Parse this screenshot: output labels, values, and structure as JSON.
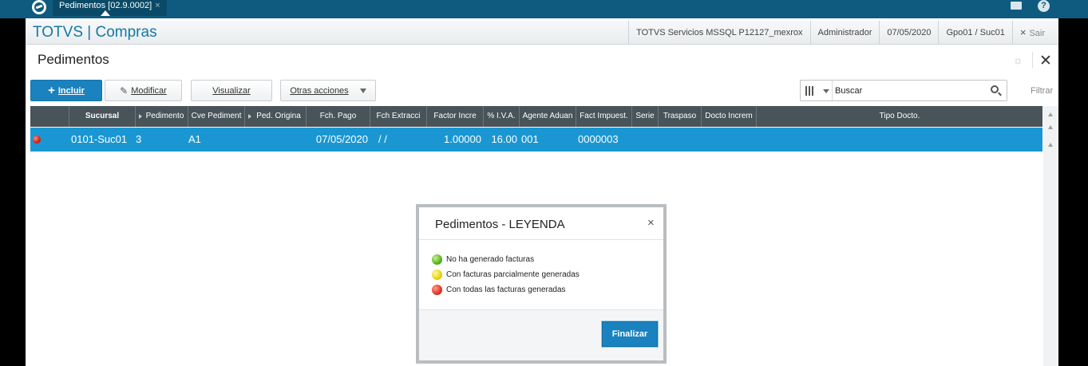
{
  "topbar": {
    "tab_label": "Pedimentos [02.9.0002]",
    "tab_close": "×"
  },
  "header": {
    "brand": "TOTVS | Compras",
    "environment": "TOTVS Servicios MSSQL P12127_mexrox",
    "user": "Administrador",
    "date": "07/05/2020",
    "branch": "Gpo01 / Suc01",
    "exit_icon": "×",
    "exit_label": "Sair"
  },
  "page": {
    "title": "Pedimentos"
  },
  "toolbar": {
    "incluir": "Incluir",
    "modificar": "Modificar",
    "visualizar": "Visualizar",
    "otras": "Otras acciones",
    "search_placeholder": "Buscar",
    "filtrar": "Filtrar"
  },
  "grid": {
    "columns": [
      "Sucursal",
      "Pedimento",
      "Cve Pediment",
      "Ped. Origina",
      "Fch. Pago",
      "Fch Extracci",
      "Factor Incre",
      "% I.V.A.",
      "Agente Aduan",
      "Fact Impuest.",
      "Serie",
      "Traspaso",
      "Docto Increm",
      "Tipo Docto."
    ],
    "rows": [
      {
        "sucursal": "0101-Suc01",
        "pedimento": "3",
        "cve": "A1",
        "ped_origina": "",
        "fch_pago": "07/05/2020",
        "fch_extraccion": "/ /",
        "factor": "1.00000",
        "iva": "16.00",
        "agente": "001",
        "fact_impuesto": "0000003",
        "serie": "",
        "traspaso": "",
        "docto_increm": "",
        "tipo_docto": ""
      }
    ]
  },
  "dialog": {
    "title": "Pedimentos - LEYENDA",
    "close": "×",
    "legend": [
      {
        "color": "green",
        "label": "No ha generado facturas"
      },
      {
        "color": "yellow",
        "label": "Con facturas parcialmente generadas"
      },
      {
        "color": "red",
        "label": "Con todas las facturas generadas"
      }
    ],
    "button": "Finalizar"
  },
  "colors": {
    "accent": "#1a82be",
    "topbar": "#0e5b7f",
    "selected_row": "#1a97d2",
    "grid_header": "#48535a"
  }
}
